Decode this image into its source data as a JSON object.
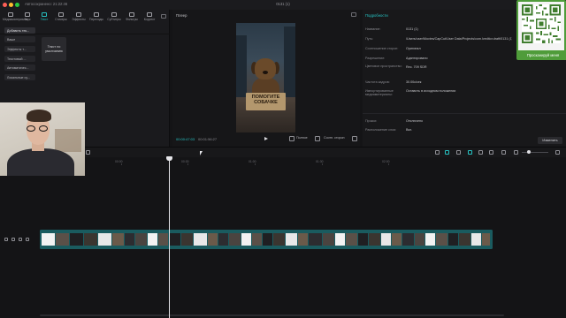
{
  "window": {
    "autosave": "Автосохранено: 21:22:46",
    "title": "0131 (1)"
  },
  "toolbar": {
    "tabs": [
      {
        "label": "Медиаматериалы",
        "icon": "media-icon",
        "active": false
      },
      {
        "label": "Звук",
        "icon": "audio-icon",
        "active": false
      },
      {
        "label": "Текст",
        "icon": "text-icon",
        "active": true
      },
      {
        "label": "Стикеры",
        "icon": "sticker-icon",
        "active": false
      },
      {
        "label": "Эффекты",
        "icon": "effects-icon",
        "active": false
      },
      {
        "label": "Переходы",
        "icon": "transitions-icon",
        "active": false
      },
      {
        "label": "Субтитры",
        "icon": "subtitles-icon",
        "active": false
      },
      {
        "label": "Фильтры",
        "icon": "filters-icon",
        "active": false
      },
      {
        "label": "Коррект",
        "icon": "adjust-icon",
        "active": false
      }
    ]
  },
  "sidebar": {
    "items": [
      {
        "label": "Добавить тек...",
        "active": true
      },
      {
        "label": "Ваше",
        "active": false
      },
      {
        "label": "Эффекты т...",
        "active": false
      },
      {
        "label": "Текстовый ...",
        "active": false
      },
      {
        "label": "Автоматичес...",
        "active": false
      },
      {
        "label": "Локальные су...",
        "active": false
      }
    ],
    "default_text_card": "Текст по умолчанию"
  },
  "player": {
    "label": "Плеер",
    "sign_line1": "ПОМОГИТЕ",
    "sign_line2": "СОБАЧКЕ",
    "current_time": "00:00:47:03",
    "total_time": "00:01:56:27",
    "full_label": "Полное",
    "ratio_label": "Соотн. сторон"
  },
  "details": {
    "label": "Подробности",
    "rows": [
      {
        "key": "Название:",
        "value": "0131 (1)"
      },
      {
        "key": "Путь:",
        "value": "/Users/user/Movies/CapCut/User Data/Projects/com.lveditor.draft/0131 (1)"
      },
      {
        "key": "Соотношение сторон:",
        "value": "Оригинал"
      },
      {
        "key": "Разрешение:",
        "value": "Адаптировано"
      },
      {
        "key": "Цветовое пространство:",
        "value": "Rec. 709 SDR"
      },
      {
        "key": "Частота кадров:",
        "value": "30.00к/сек"
      },
      {
        "key": "Импортированные медиаматериалы:",
        "value": "Оставить в исходном положении"
      },
      {
        "key": "Прокси:",
        "value": "Отключено"
      },
      {
        "key": "Расположение слоя:",
        "value": "Вкл."
      }
    ],
    "change_button": "Изменить"
  },
  "qr": {
    "caption": "Просканируй меня"
  },
  "timeline": {
    "ticks": [
      "00:00",
      "00:30",
      "01:00",
      "01:30",
      "02:00"
    ]
  },
  "colors": {
    "accent": "#26c3c3",
    "track": "#1a5b5f",
    "qr_green": "#4f9c3a"
  }
}
